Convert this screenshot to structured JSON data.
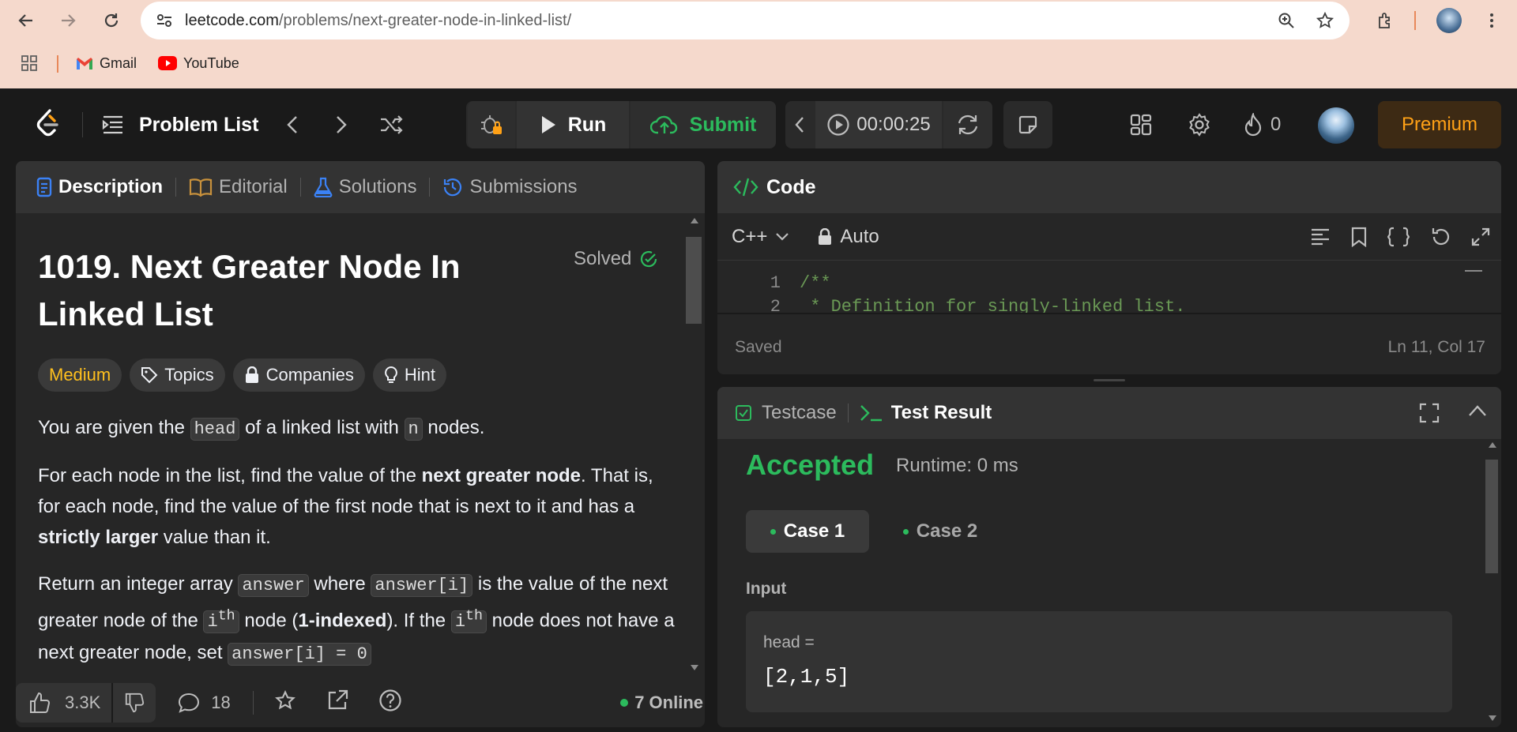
{
  "browser": {
    "url_host": "leetcode.com",
    "url_path": "/problems/next-greater-node-in-linked-list/",
    "bookmarks": [
      {
        "label": "Gmail"
      },
      {
        "label": "YouTube"
      }
    ]
  },
  "toolbar": {
    "problem_list_label": "Problem List",
    "run_label": "Run",
    "submit_label": "Submit",
    "timer": "00:00:25",
    "streak_count": "0",
    "premium_label": "Premium"
  },
  "left_panel": {
    "tabs": [
      "Description",
      "Editorial",
      "Solutions",
      "Submissions"
    ],
    "title_line1": "1019. Next Greater Node In",
    "title_line2": "Linked List",
    "solved_label": "Solved",
    "difficulty": "Medium",
    "topics_label": "Topics",
    "companies_label": "Companies",
    "hint_label": "Hint",
    "para1": {
      "a": "You are given the ",
      "code1": "head",
      "b": " of a linked list with ",
      "code2": "n",
      "c": " nodes."
    },
    "para2": {
      "a": "For each node in the list, find the value of the ",
      "bold1": "next greater node",
      "b": ". That is, for each node, find the value of the first node that is next to it and has a ",
      "bold2": "strictly larger",
      "c": " value than it."
    },
    "para3": {
      "a": "Return an integer array ",
      "code1": "answer",
      "b": " where ",
      "code2": "answer[i]",
      "c": " is the value of the next greater node of the ",
      "code3": "i",
      "sup": "th",
      "d": " node (",
      "bold1": "1-indexed",
      "e": "). If the ",
      "code4": "i",
      "sup2": "th",
      "f": " node does not have a next greater node, set ",
      "code5": "answer[i] = 0"
    },
    "likes": "3.3K",
    "comments": "18",
    "online": "7 Online"
  },
  "code_panel": {
    "title": "Code",
    "language": "C++",
    "mode": "Auto",
    "line1_num": "1",
    "line1_text": "/**",
    "line2_num": "2",
    "line2_text": " * Definition for singly-linked list.",
    "status": "Saved",
    "cursor": "Ln 11, Col 17"
  },
  "test_panel": {
    "testcase_tab": "Testcase",
    "result_tab": "Test Result",
    "verdict": "Accepted",
    "runtime": "Runtime: 0 ms",
    "case1": "Case 1",
    "case2": "Case 2",
    "input_label": "Input",
    "var_label": "head =",
    "var_value": "[2,1,5]"
  },
  "colors": {
    "accent_green": "#2cbb5d",
    "accent_orange": "#ffa116",
    "medium": "#ffc01e",
    "premium_bg": "#3d2a14"
  }
}
